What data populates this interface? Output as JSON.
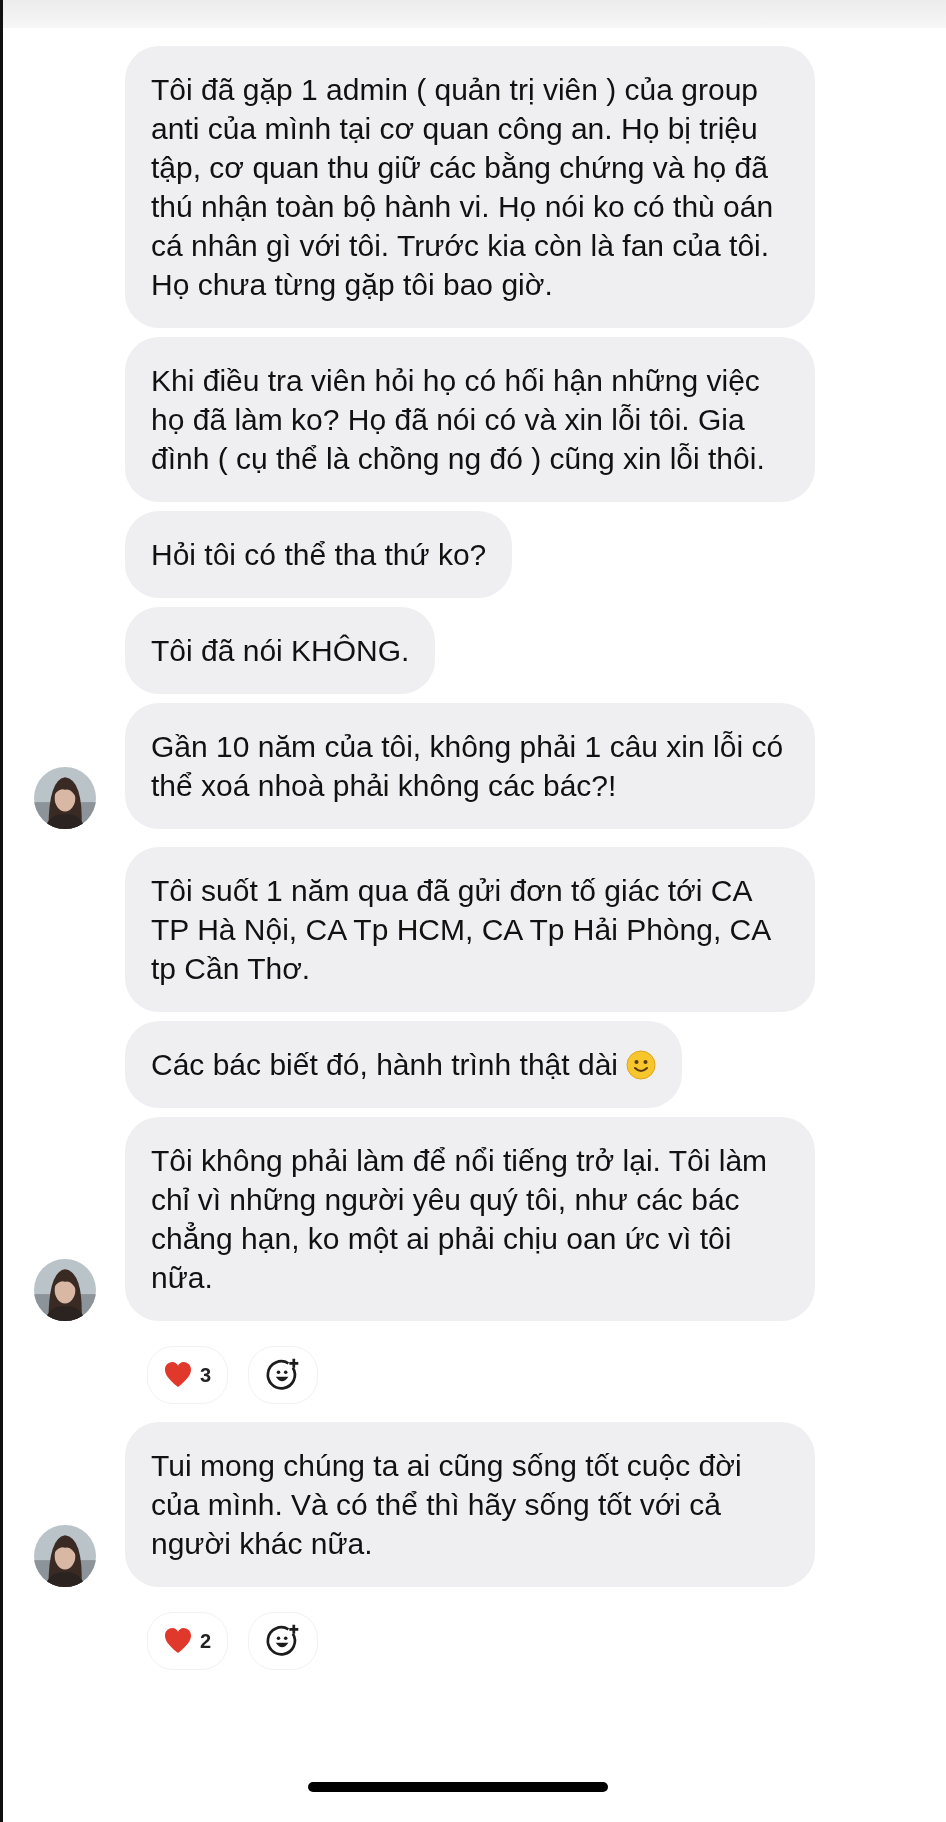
{
  "groups": [
    {
      "messages": [
        {
          "text": "Tôi đã gặp 1 admin ( quản trị viên ) của group anti của mình tại cơ quan công an. Họ bị triệu tập, cơ quan thu giữ các bằng chứng và họ đã thú nhận toàn bộ hành vi. Họ nói ko có thù oán cá nhân gì với tôi. Trước kia còn là fan của tôi. Họ chưa từng gặp tôi bao giờ.",
          "smiley": false
        },
        {
          "text": "Khi điều tra viên hỏi họ có hối hận những việc họ đã làm ko? Họ đã nói có và xin lỗi tôi. Gia đình ( cụ thể là chồng ng đó ) cũng xin lỗi thôi.",
          "smiley": false
        },
        {
          "text": "Hỏi tôi có thể tha thứ ko?",
          "smiley": false
        },
        {
          "text": "Tôi đã nói KHÔNG.",
          "smiley": false
        },
        {
          "text": "Gần 10 năm của tôi, không phải 1 câu xin lỗi có thể xoá nhoà phải không các bác?!",
          "smiley": false
        }
      ]
    },
    {
      "messages": [
        {
          "text": "Tôi suốt 1 năm qua đã gửi đơn tố giác tới CA TP Hà Nội, CA Tp HCM, CA Tp Hải Phòng, CA tp Cần Thơ.",
          "smiley": false
        },
        {
          "text": "Các bác biết đó, hành trình thật dài",
          "smiley": true
        },
        {
          "text": "Tôi không phải làm để nổi tiếng trở lại. Tôi làm chỉ vì những người yêu quý tôi, như các bác chẳng hạn, ko một ai phải chịu oan ức vì tôi nữa.",
          "smiley": false
        }
      ],
      "reaction_count": "3"
    },
    {
      "messages": [
        {
          "text": "Tui mong chúng ta ai cũng sống tốt cuộc đời của mình. Và có thể thì hãy sống tốt với cả người khác nữa.",
          "smiley": false
        }
      ],
      "reaction_count": "2"
    }
  ]
}
